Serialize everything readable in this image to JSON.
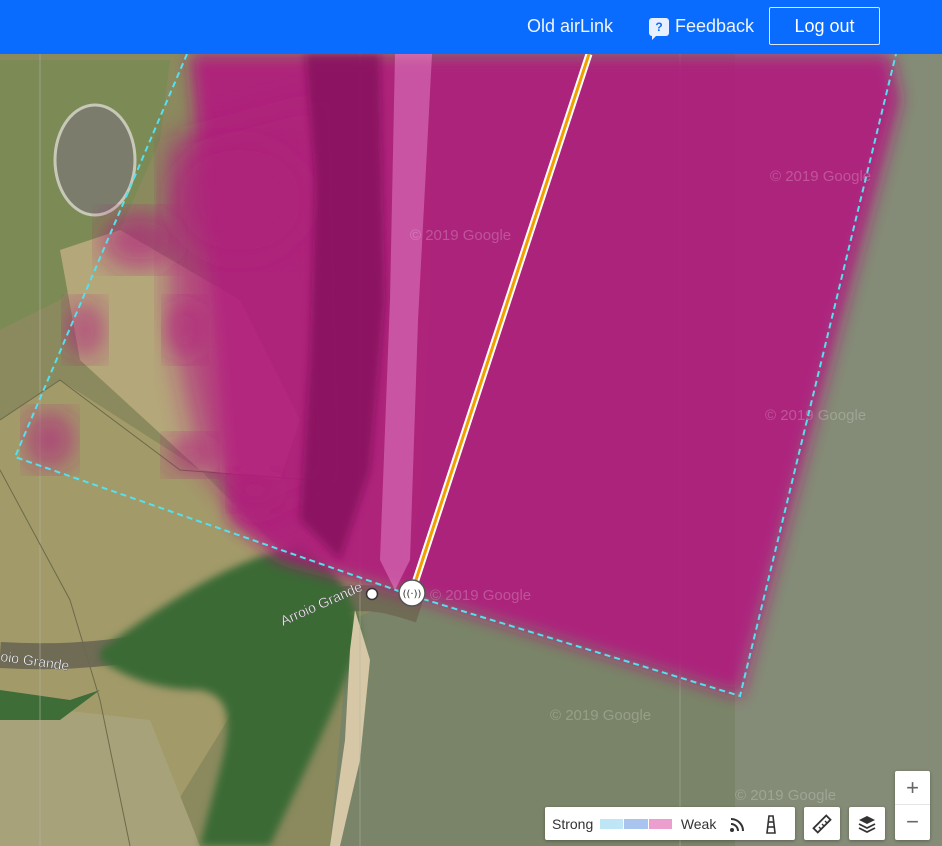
{
  "header": {
    "old_airlink_label": "Old airLink",
    "feedback_icon_glyph": "?",
    "feedback_label": "Feedback",
    "logout_label": "Log out",
    "background_color": "#0a6cff"
  },
  "map": {
    "watermark": "© 2019 Google",
    "river_labels": [
      "Arroio Grande",
      "oio Grande"
    ],
    "coverage_color": "#b3157f",
    "link_line_color": "#f2a000",
    "boundary_color": "#55e0f0"
  },
  "legend": {
    "strong_label": "Strong",
    "weak_label": "Weak",
    "swatches": [
      "#bfe6f7",
      "#aac4f0",
      "#ec9fcf"
    ],
    "icons": [
      "signal-icon",
      "tower-icon"
    ]
  },
  "controls": {
    "ruler_icon": "ruler-icon",
    "layers_icon": "layers-icon",
    "zoom_in_label": "+",
    "zoom_out_label": "−"
  }
}
